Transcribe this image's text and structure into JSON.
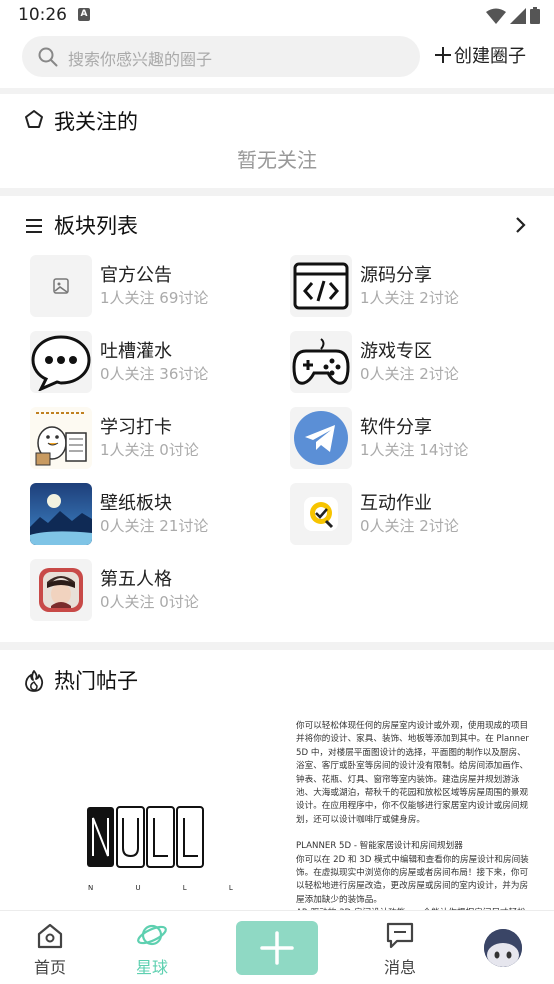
{
  "status_bar": {
    "time": "10:26",
    "notification_badge": "A"
  },
  "search": {
    "placeholder": "搜索你感兴趣的圈子",
    "create_label": "创建圈子"
  },
  "following": {
    "title": "我关注的",
    "empty_text": "暂无关注"
  },
  "boards": {
    "title": "板块列表",
    "items": [
      {
        "name": "官方公告",
        "stats": "1人关注 69讨论",
        "icon": "image-placeholder-icon"
      },
      {
        "name": "源码分享",
        "stats": "1人关注 2讨论",
        "icon": "code-icon"
      },
      {
        "name": "吐槽灌水",
        "stats": "0人关注 36讨论",
        "icon": "chat-bubble-icon"
      },
      {
        "name": "游戏专区",
        "stats": "0人关注 2讨论",
        "icon": "gamepad-icon"
      },
      {
        "name": "学习打卡",
        "stats": "1人关注 0讨论",
        "icon": "duck-sticker-icon"
      },
      {
        "name": "软件分享",
        "stats": "1人关注 14讨论",
        "icon": "telegram-icon"
      },
      {
        "name": "壁纸板块",
        "stats": "0人关注 21讨论",
        "icon": "wallpaper-image"
      },
      {
        "name": "互动作业",
        "stats": "0人关注 2讨论",
        "icon": "q-logo-icon"
      },
      {
        "name": "第五人格",
        "stats": "0人关注 0讨论",
        "icon": "game-avatar-image"
      }
    ]
  },
  "hot_posts": {
    "title": "热门帖子",
    "post_image_logo": "NULL",
    "post_image_sub": "N U L L",
    "post_text_1": "你可以轻松体现任何的房屋室内设计或外观，使用现成的项目并将你的设计、家具、装饰、地板等添加到其中。在 Planner 5D 中，对楼层平面图设计的选择，平面图的制作以及厨房、浴室、客厅或卧室等房间的设计没有限制。给房间添加画作、钟表、花瓶、灯具、窗帘等室内装饰。建造房屋并规划游泳池、大海或湖泊，帮秋千的花园和放松区域等房屋周围的景观设计。在应用程序中，你不仅能够进行家居室内设计或房间规划，还可以设计咖啡厅或健身房。",
    "post_text_2": "PLANNER 5D - 智能家居设计和房间规划器\n你可以在 2D 和 3D 模式中编辑和查看你的房屋设计和房间装饰。在虚拟现实中浏览你的房屋或者房间布局！接下来，你可以轻松地进行房屋改造，更改房屋或房间的室内设计，并为房屋添加缺少的装饰品。\nAR 驱动的 3D 房间设计功能 - 一个能让你根据房间尺寸轻松"
  },
  "tab_bar": {
    "home_label": "首页",
    "planet_label": "星球",
    "messages_label": "消息",
    "colors": {
      "active": "#5ed0b0",
      "plus_button": "#8fd9c4"
    }
  }
}
